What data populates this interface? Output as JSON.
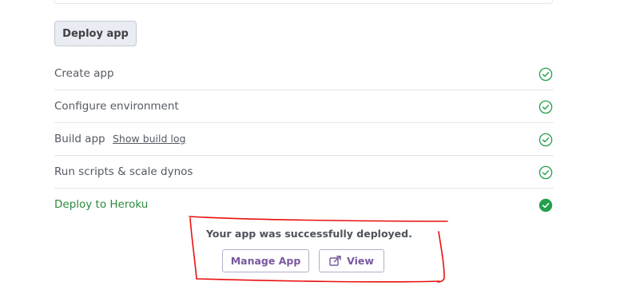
{
  "deploy_button": {
    "label": "Deploy app"
  },
  "steps": [
    {
      "label": "Create app",
      "status": "done",
      "icon": "check-circle-outline-icon"
    },
    {
      "label": "Configure environment",
      "status": "done",
      "icon": "check-circle-outline-icon"
    },
    {
      "label": "Build app",
      "link": "Show build log",
      "status": "done",
      "icon": "check-circle-outline-icon"
    },
    {
      "label": "Run scripts & scale dynos",
      "status": "done",
      "icon": "check-circle-outline-icon"
    },
    {
      "label": "Deploy to Heroku",
      "status": "complete",
      "icon": "check-circle-filled-icon"
    }
  ],
  "result": {
    "message": "Your app was successfully deployed.",
    "manage_label": "Manage App",
    "view_label": "View",
    "view_icon": "external-link-icon"
  },
  "colors": {
    "success_green": "#2d8a3e",
    "check_green": "#22a04b",
    "action_purple": "#79589f",
    "annotation_red": "#e8100f"
  }
}
